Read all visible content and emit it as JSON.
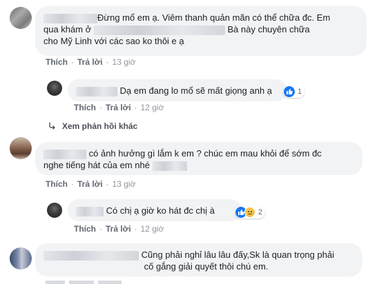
{
  "comments": [
    {
      "text_l1": "Đừng mổ em ạ. Viêm thanh quản mãn có thể chữa đc. Em",
      "text_l2a": "qua khám ở",
      "text_l2b": "Bà này chuyên chữa",
      "text_l3": "cho Mỹ Linh với các sao ko thôi e ạ",
      "like": "Thích",
      "reply": "Trả lời",
      "time": "13 giờ"
    },
    {
      "text": "Dạ em đang lo mổ sẽ mất giọng anh ạ",
      "reactions": "1",
      "like": "Thích",
      "reply": "Trả lời",
      "time": "12 giờ"
    },
    {
      "text_l1": "có ảnh hưởng gì lắm k em ? chúc em mau khỏi để sớm đc",
      "text_l2": "nghe tiếng hát của em nhé",
      "like": "Thích",
      "reply": "Trả lời",
      "time": "13 giờ"
    },
    {
      "text": "Có chị ạ giờ ko hát đc chị à",
      "reactions": "2",
      "like": "Thích",
      "reply": "Trả lời",
      "time": "12 giờ"
    },
    {
      "text_l1": "Cũng phải nghỉ lâu lâu đấy,Sk là quan trọng phải",
      "text_l2": "cố gắng giải quyết thôi chú em."
    }
  ],
  "more_replies": "Xem phản hồi khác",
  "colors": {
    "like_blue": "#1877f2",
    "bubble": "#f2f3f5",
    "meta": "#606770"
  }
}
